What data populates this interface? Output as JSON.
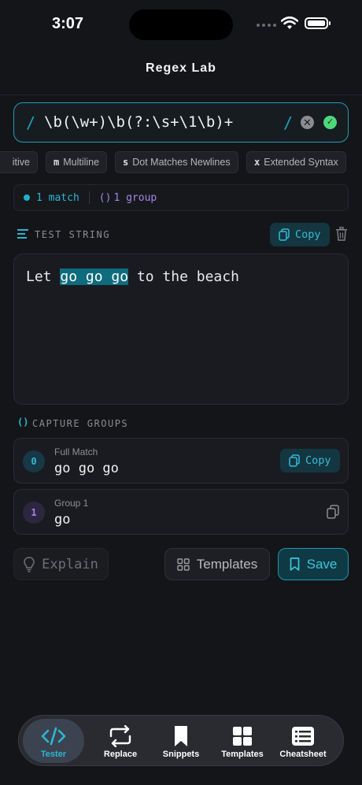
{
  "status_bar": {
    "time": "3:07"
  },
  "nav": {
    "title": "Regex Lab"
  },
  "regex": {
    "open_delim": "/",
    "pattern": "\\b(\\w+)\\b(?:\\s+\\1\\b)+",
    "close_delim": "/",
    "clear_glyph": "✕",
    "valid_glyph": "✓"
  },
  "flags": [
    {
      "key": "",
      "label": "itive"
    },
    {
      "key": "m",
      "label": "Multiline"
    },
    {
      "key": "s",
      "label": "Dot Matches Newlines"
    },
    {
      "key": "x",
      "label": "Extended Syntax"
    }
  ],
  "summary": {
    "matches": "1 match",
    "groups_glyph": "()",
    "groups": "1 group"
  },
  "test_string": {
    "section_label": "TEST STRING",
    "copy_label": "Copy",
    "before": "Let ",
    "match": "go go go",
    "after": " to the beach"
  },
  "capture_groups": {
    "section_glyph": "()",
    "section_label": "CAPTURE GROUPS",
    "items": [
      {
        "index": "0",
        "name": "Full Match",
        "value": "go go go",
        "copy_label": "Copy"
      },
      {
        "index": "1",
        "name": "Group 1",
        "value": "go"
      }
    ]
  },
  "actions": {
    "explain": "Explain",
    "templates": "Templates",
    "save": "Save"
  },
  "tabs": [
    {
      "label": "Tester",
      "icon": "code-icon",
      "active": true
    },
    {
      "label": "Replace",
      "icon": "replace-icon",
      "active": false
    },
    {
      "label": "Snippets",
      "icon": "bookmark-icon",
      "active": false
    },
    {
      "label": "Templates",
      "icon": "grid-icon",
      "active": false
    },
    {
      "label": "Cheatsheet",
      "icon": "list-icon",
      "active": false
    }
  ],
  "colors": {
    "accent": "#1ea2b8",
    "background": "#141519",
    "match_highlight": "#0f6c7d",
    "group_purple": "#a486e5",
    "valid_green": "#4fd77a"
  }
}
